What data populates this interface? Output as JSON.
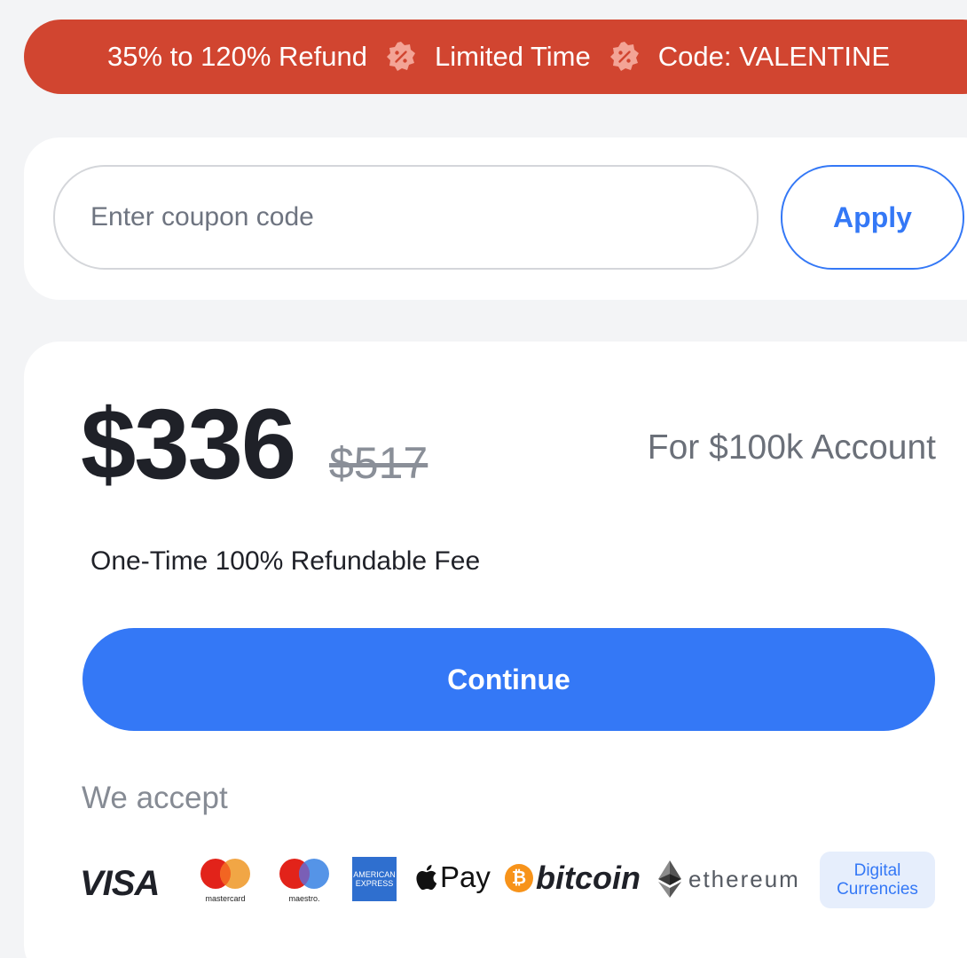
{
  "promo": {
    "refund_text": "35% to 120% Refund",
    "limited_text": "Limited Time",
    "code_text": "Code: VALENTINE",
    "background_color": "#d14530",
    "badge_icon": "percent-badge-icon"
  },
  "coupon": {
    "placeholder": "Enter coupon code",
    "value": "",
    "apply_label": "Apply"
  },
  "pricing": {
    "current_price": "$336",
    "original_price": "$517",
    "account_label": "For $100k Account",
    "fee_label": "One-Time 100% Refundable Fee",
    "continue_label": "Continue",
    "accent_color": "#3478f6"
  },
  "payments": {
    "accept_label": "We accept",
    "methods": {
      "visa": "VISA",
      "mastercard": "mastercard",
      "maestro": "maestro.",
      "amex_line1": "AMERICAN",
      "amex_line2": "EXPRESS",
      "apple_pay": "Pay",
      "bitcoin": "bitcoin",
      "bitcoin_symbol": "₿",
      "ethereum": "ethereum",
      "digital_line1": "Digital",
      "digital_line2": "Currencies"
    }
  }
}
